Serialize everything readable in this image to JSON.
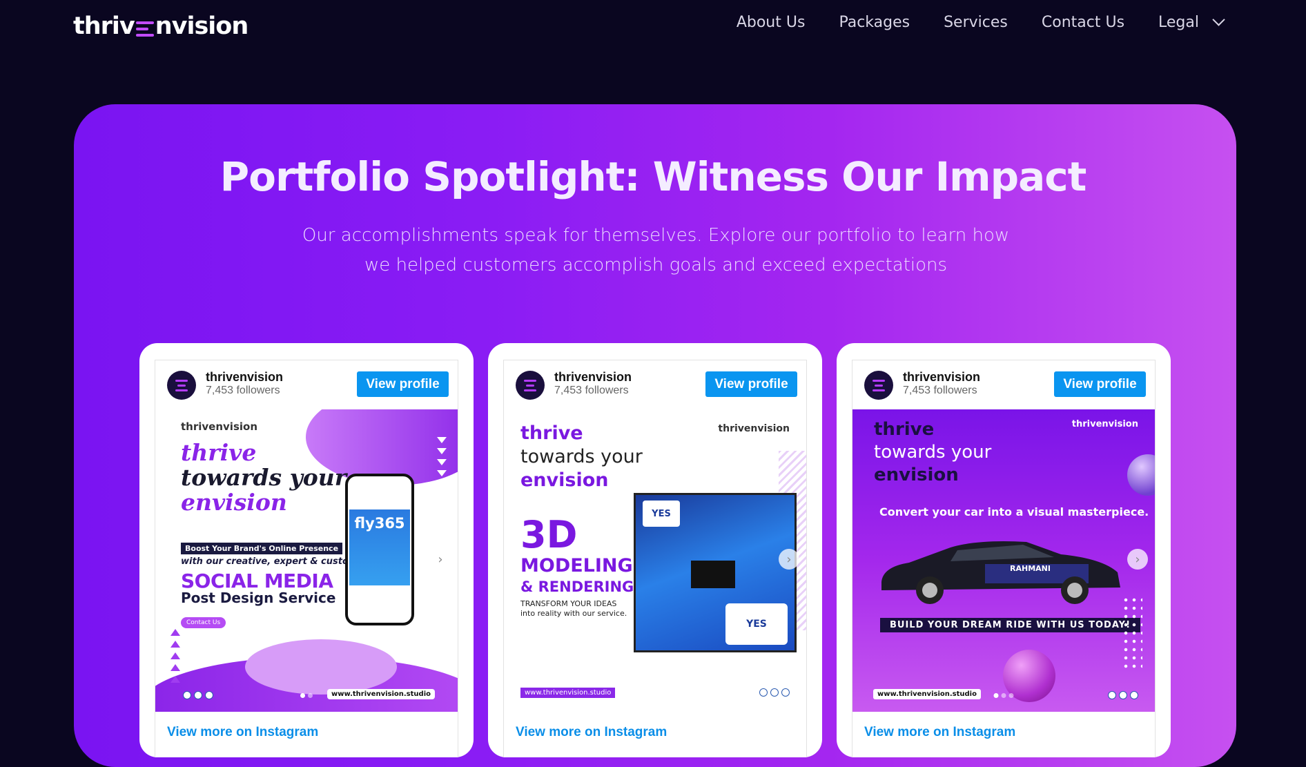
{
  "nav": {
    "logo_left": "thriv",
    "logo_right": "nvision",
    "items": [
      {
        "label": "About Us"
      },
      {
        "label": "Packages"
      },
      {
        "label": "Services"
      },
      {
        "label": "Contact Us"
      },
      {
        "label": "Legal"
      }
    ]
  },
  "hero": {
    "title": "Portfolio Spotlight: Witness Our Impact",
    "subtitle": "Our accomplishments speak for themselves. Explore our portfolio to learn how we helped customers accomplish goals and exceed expectations"
  },
  "cards": [
    {
      "username": "thrivenvision",
      "followers": "7,453 followers",
      "button": "View profile",
      "more": "View more on Instagram",
      "post": {
        "logo": "thrivenvision",
        "line1": "thrive",
        "line2": "towards your",
        "line3": "envision",
        "tag": "Boost Your Brand's Online Presence",
        "with": "with our creative, expert & custom",
        "big": "SOCIAL MEDIA",
        "sub": "Post Design Service",
        "cta": "Contact Us",
        "phone_brand": "fly365",
        "url": "www.thrivenvision.studio"
      }
    },
    {
      "username": "thrivenvision",
      "followers": "7,453 followers",
      "button": "View profile",
      "more": "View more on Instagram",
      "post": {
        "logo": "thrivenvision",
        "line1": "thrive",
        "line2": "towards your",
        "line3": "envision",
        "big": "3D",
        "big2": "MODELING",
        "big3": "& RENDERING",
        "tr1": "TRANSFORM YOUR IDEAS",
        "tr2": "into reality with our service.",
        "sign": "YES",
        "url": "www.thrivenvision.studio"
      }
    },
    {
      "username": "thrivenvision",
      "followers": "7,453 followers",
      "button": "View profile",
      "more": "View more on Instagram",
      "post": {
        "logo": "thrivenvision",
        "line1": "thrive",
        "line2": "towards your",
        "line3": "envision",
        "convert": "Convert your car into a visual masterpiece.",
        "door": "RAHMANI",
        "build": "BUILD YOUR DREAM RIDE WITH US TODAY!",
        "url": "www.thrivenvision.studio"
      }
    }
  ],
  "colors": {
    "background": "#0a0620",
    "hero_start": "#7a14f2",
    "hero_end": "#c650f0",
    "button": "#0a95f0",
    "link": "#0a8ee8"
  }
}
